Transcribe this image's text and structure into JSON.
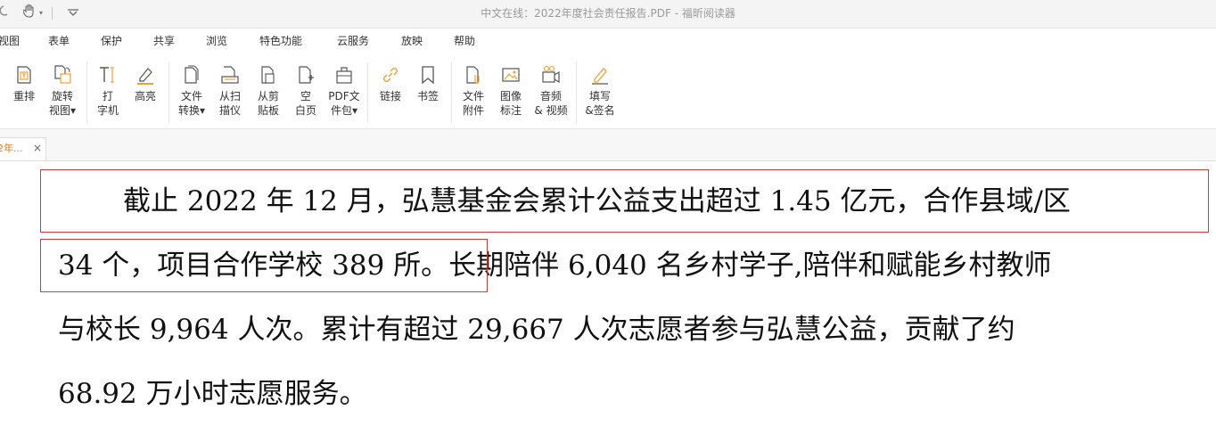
{
  "window": {
    "title": "中文在线：2022年度社会责任报告.PDF - 福昕阅读器"
  },
  "toolbar": {
    "undo_icon": "undo-icon",
    "hand_icon": "hand-icon",
    "dropdown_caret": "▾",
    "customize_icon": "chevron-down-icon"
  },
  "menu": [
    {
      "label": "视图"
    },
    {
      "label": "表单"
    },
    {
      "label": "保护"
    },
    {
      "label": "共享"
    },
    {
      "label": "浏览"
    },
    {
      "label": "特色功能"
    },
    {
      "label": "云服务"
    },
    {
      "label": "放映"
    },
    {
      "label": "帮助"
    }
  ],
  "ribbon": [
    {
      "label": "重排",
      "icon": "reflow-icon"
    },
    {
      "label": "旋转\n视图▾",
      "icon": "rotate-view-icon"
    },
    {
      "label": "打\n字机",
      "icon": "typewriter-icon"
    },
    {
      "label": "高亮",
      "icon": "highlight-icon"
    },
    {
      "label": "文件\n转换▾",
      "icon": "file-convert-icon"
    },
    {
      "label": "从扫\n描仪",
      "icon": "scanner-icon"
    },
    {
      "label": "从剪\n贴板",
      "icon": "clipboard-icon"
    },
    {
      "label": "空\n白页",
      "icon": "blank-page-icon"
    },
    {
      "label": "PDF文\n件包▾",
      "icon": "pdf-package-icon"
    },
    {
      "label": "链接",
      "icon": "link-icon"
    },
    {
      "label": "书签",
      "icon": "bookmark-icon"
    },
    {
      "label": "文件\n附件",
      "icon": "file-attachment-icon"
    },
    {
      "label": "图像\n标注",
      "icon": "image-annotation-icon"
    },
    {
      "label": "音频\n& 视频",
      "icon": "audio-video-icon"
    },
    {
      "label": "填写\n&签名",
      "icon": "fill-sign-icon"
    }
  ],
  "tab": {
    "label": "2年...",
    "close": "×"
  },
  "document": {
    "lines": [
      "截止 2022 年 12 月，弘慧基金会累计公益支出超过 1.45 亿元，合作县域/区",
      "34 个，项目合作学校 389 所。长期陪伴 6,040 名乡村学子,陪伴和赋能乡村教师",
      "与校长 9,964 人次。累计有超过 29,667 人次志愿者参与弘慧公益，贡献了约",
      "68.92 万小时志愿服务。"
    ]
  },
  "colors": {
    "accent": "#e07a1e",
    "highlight_border": "#d8383a",
    "link_orange": "#f0a030"
  }
}
